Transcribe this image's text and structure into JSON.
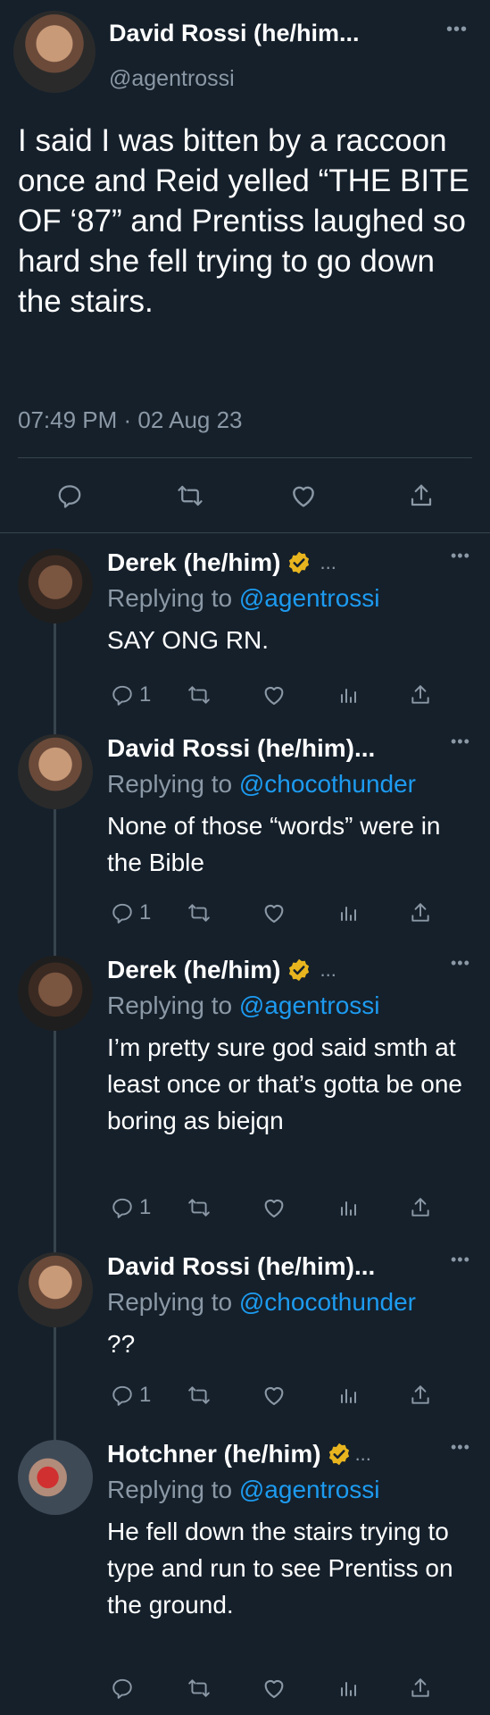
{
  "main_tweet": {
    "name": "David Rossi (he/him...",
    "handle": "@agentrossi",
    "text": "I said I was bitten by a raccoon once and Reid yelled “THE BITE OF ‘87” and Prentiss laughed so hard she fell trying to go down the stairs.",
    "timestamp": "07:49 PM · 02 Aug 23",
    "actions": [
      "reply-icon",
      "retweet-icon",
      "like-icon",
      "share-icon"
    ]
  },
  "replies": [
    {
      "name": "Derek (he/him)",
      "verified": true,
      "replying_label": "Replying to",
      "mention": "@agentrossi",
      "text": "SAY ONG RN.",
      "reply_count": "1"
    },
    {
      "name": "David Rossi (he/him)...",
      "verified": false,
      "replying_label": "Replying to",
      "mention": "@chocothunder",
      "text": "None of those “words” were in the Bible",
      "reply_count": "1"
    },
    {
      "name": "Derek (he/him)",
      "verified": true,
      "replying_label": "Replying to",
      "mention": "@agentrossi",
      "text": "I’m pretty sure god said smth at least once or that’s gotta be one boring as biejqn",
      "reply_count": "1"
    },
    {
      "name": "David Rossi (he/him)...",
      "verified": false,
      "replying_label": "Replying to",
      "mention": "@chocothunder",
      "text": "??",
      "reply_count": "1"
    },
    {
      "name": "Hotchner (he/him)",
      "verified": true,
      "replying_label": "Replying to",
      "mention": "@agentrossi",
      "text": "He fell down the stairs trying to type and run to see Prentiss on the ground.",
      "reply_count": ""
    }
  ],
  "ellipsis": "...",
  "more_dots": "•••",
  "colors": {
    "background": "#15202b",
    "secondary_text": "#8b98a5",
    "link": "#1d9bf0",
    "verified_badge": "#e8b51f",
    "divider": "#38444d"
  }
}
